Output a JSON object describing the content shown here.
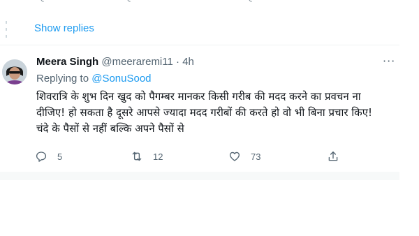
{
  "thread": {
    "show_replies_label": "Show replies"
  },
  "tweet": {
    "author_name": "Meera Singh",
    "author_handle": "@meeraremi11",
    "separator": "·",
    "timestamp": "4h",
    "more_label": "···",
    "replying_prefix": "Replying to",
    "replying_to": "@SonuSood",
    "text_lines": [
      "शिवरात्रि के शुभ दिन खुद को पैगम्बर मानकर किसी गरीब की मदद करने का प्रवचन ना",
      "दीजिए! हो सकता है दूसरे आपसे ज्यादा मदद गरीबों की करते हो वो भी बिना प्रचार किए!",
      "चंदे के पैसों से नहीं बल्कि अपने पैसों से"
    ],
    "actions": {
      "reply_count": "5",
      "retweet_count": "12",
      "like_count": "73",
      "share_count": ""
    }
  },
  "icons": {
    "reply": "reply-icon",
    "retweet": "retweet-icon",
    "like": "like-icon",
    "share": "share-icon",
    "more": "more-icon"
  },
  "colors": {
    "accent": "#1d9bf0",
    "secondary_text": "#536471",
    "primary_text": "#0f1419",
    "divider": "#eff3f4"
  }
}
